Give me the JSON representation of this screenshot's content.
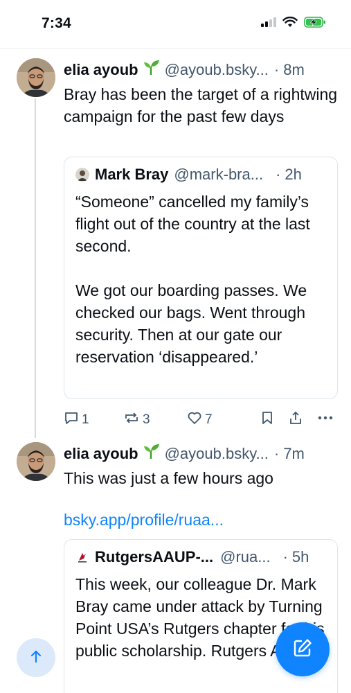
{
  "status_bar": {
    "time": "7:34",
    "icons": [
      "cellular-signal-icon",
      "wifi-icon",
      "battery-charging-icon"
    ]
  },
  "posts": [
    {
      "author": "elia ayoub",
      "emoji_icon": "sprout-icon",
      "handle": "@ayoub.bsky...",
      "time": "8m",
      "text": "Bray has been the target of a rightwing campaign for the past few days",
      "quote": {
        "author": "Mark Bray",
        "handle": "@mark-bra...",
        "time": "2h",
        "text": "“Someone” cancelled my family’s flight out of the country at the last second.\n\nWe got our boarding passes. We checked our bags. Went through security. Then at our gate our reservation ‘disappeared.’"
      },
      "actions": {
        "replies": "1",
        "reposts": "3",
        "likes": "7"
      }
    },
    {
      "author": "elia ayoub",
      "emoji_icon": "sprout-icon",
      "handle": "@ayoub.bsky...",
      "time": "7m",
      "text": "This was just a few hours ago",
      "link": "bsky.app/profile/ruaa...",
      "quote": {
        "author": "RutgersAAUP-...",
        "handle": "@rua...",
        "time": "5h",
        "text": "This week, our colleague Dr. Mark Bray came under attack by Turning Point USA’s Rutgers chapter for his public scholarship. Rutgers AAUP-"
      }
    }
  ],
  "colors": {
    "accent": "#1083fe",
    "muted_text": "#42576c",
    "border": "#dfe5eb",
    "thread_line": "#d3dbe4"
  }
}
